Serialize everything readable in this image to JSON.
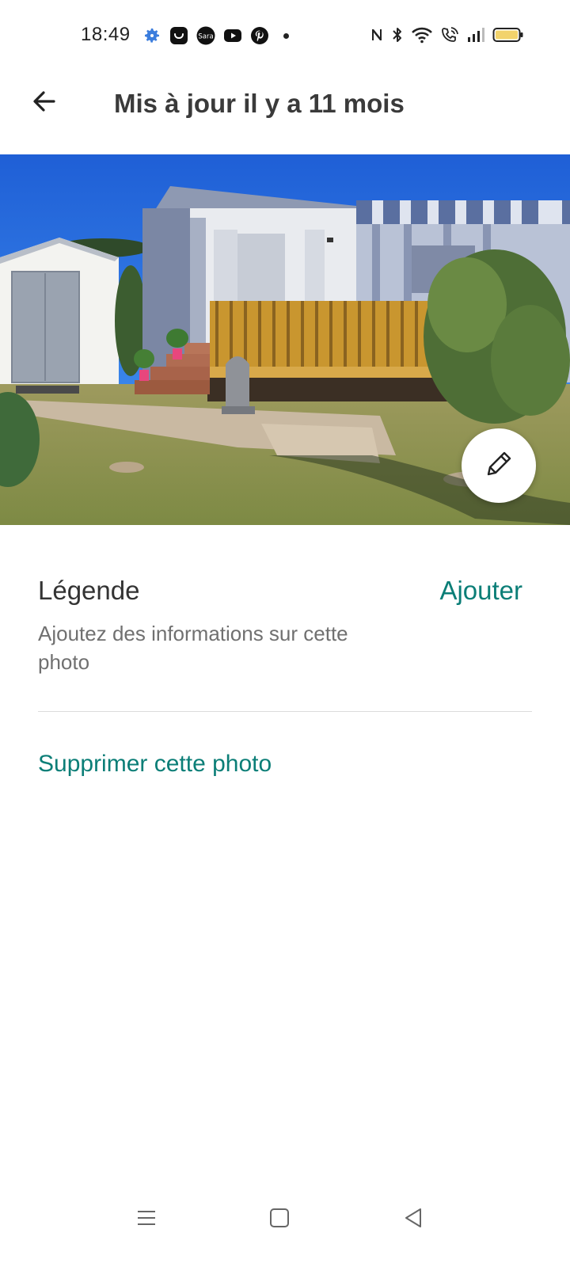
{
  "status_bar": {
    "time": "18:49",
    "left_icons": [
      "settings-gear-icon",
      "shopping-bag-icon",
      "sara-app-icon",
      "youtube-icon",
      "pinterest-icon",
      "more-dot-icon"
    ],
    "right_icons": [
      "nfc-icon",
      "bluetooth-icon",
      "wifi-icon",
      "wifi-calling-icon",
      "signal-icon",
      "battery-icon"
    ],
    "battery_color": "#f2d36b"
  },
  "header": {
    "back_icon": "arrow-left-icon",
    "title": "Mis à jour il y a 11 mois"
  },
  "photo": {
    "edit_icon": "pencil-icon"
  },
  "caption": {
    "title": "Légende",
    "action": "Ajouter",
    "description": "Ajoutez des informations sur cette photo"
  },
  "actions": {
    "delete": "Supprimer cette photo"
  },
  "colors": {
    "accent": "#0b7e77",
    "title": "#3a3a3a",
    "muted": "#707070"
  },
  "nav_bar": {
    "icons": [
      "menu-icon",
      "home-square-icon",
      "back-triangle-icon"
    ]
  }
}
